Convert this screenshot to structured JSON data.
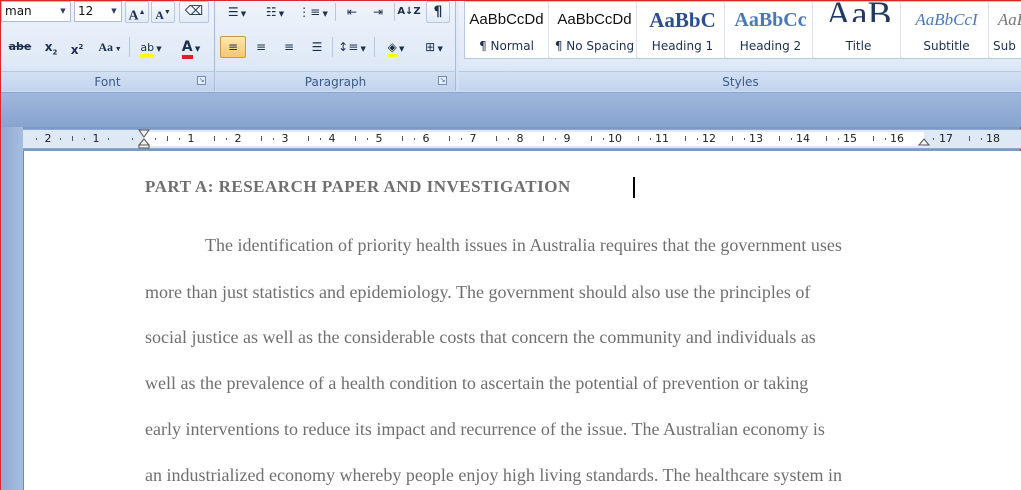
{
  "ribbon": {
    "font": {
      "font_name": "man",
      "font_size": "12",
      "grow_label": "A",
      "shrink_label": "A",
      "strike_label": "abe",
      "subscript_label": "x",
      "superscript_label": "x",
      "case_label": "Aa",
      "highlight_label": "ab",
      "color_label": "A",
      "group_label": "Font",
      "highlight_color": "#ffff00",
      "font_color": "#e02020"
    },
    "paragraph": {
      "group_label": "Paragraph",
      "sort_label": "A↓Z",
      "show_marks_label": "¶"
    },
    "styles": {
      "group_label": "Styles",
      "items": [
        {
          "preview": "AaBbCcDd",
          "name": "¶ Normal"
        },
        {
          "preview": "AaBbCcDd",
          "name": "¶ No Spacing"
        },
        {
          "preview": "AaBbC",
          "name": "Heading 1"
        },
        {
          "preview": "AaBbCc",
          "name": "Heading 2"
        },
        {
          "preview": "AaB",
          "name": "Title"
        },
        {
          "preview": "AaBbCcI",
          "name": "Subtitle"
        },
        {
          "preview": "AaB",
          "name": "Sub"
        }
      ]
    }
  },
  "ruler": {
    "labels": [
      "2",
      "1",
      "1",
      "2",
      "3",
      "4",
      "5",
      "6",
      "7",
      "8",
      "9",
      "10",
      "11",
      "12",
      "13",
      "14",
      "15",
      "16",
      "17",
      "18"
    ]
  },
  "document": {
    "heading": "PART A: RESEARCH PAPER AND INVESTIGATION",
    "lines": [
      "The identification of priority health issues in Australia requires that the government uses",
      "more than just statistics and epidemiology. The government should also use the principles of",
      "social justice as well as the considerable costs that concern the community and individuals as",
      "well as the prevalence of a health condition to ascertain the potential of prevention or taking",
      "early interventions to reduce its impact and recurrence of the issue. The Australian economy is",
      "an industrialized economy whereby people enjoy high living standards. The healthcare system in"
    ]
  }
}
